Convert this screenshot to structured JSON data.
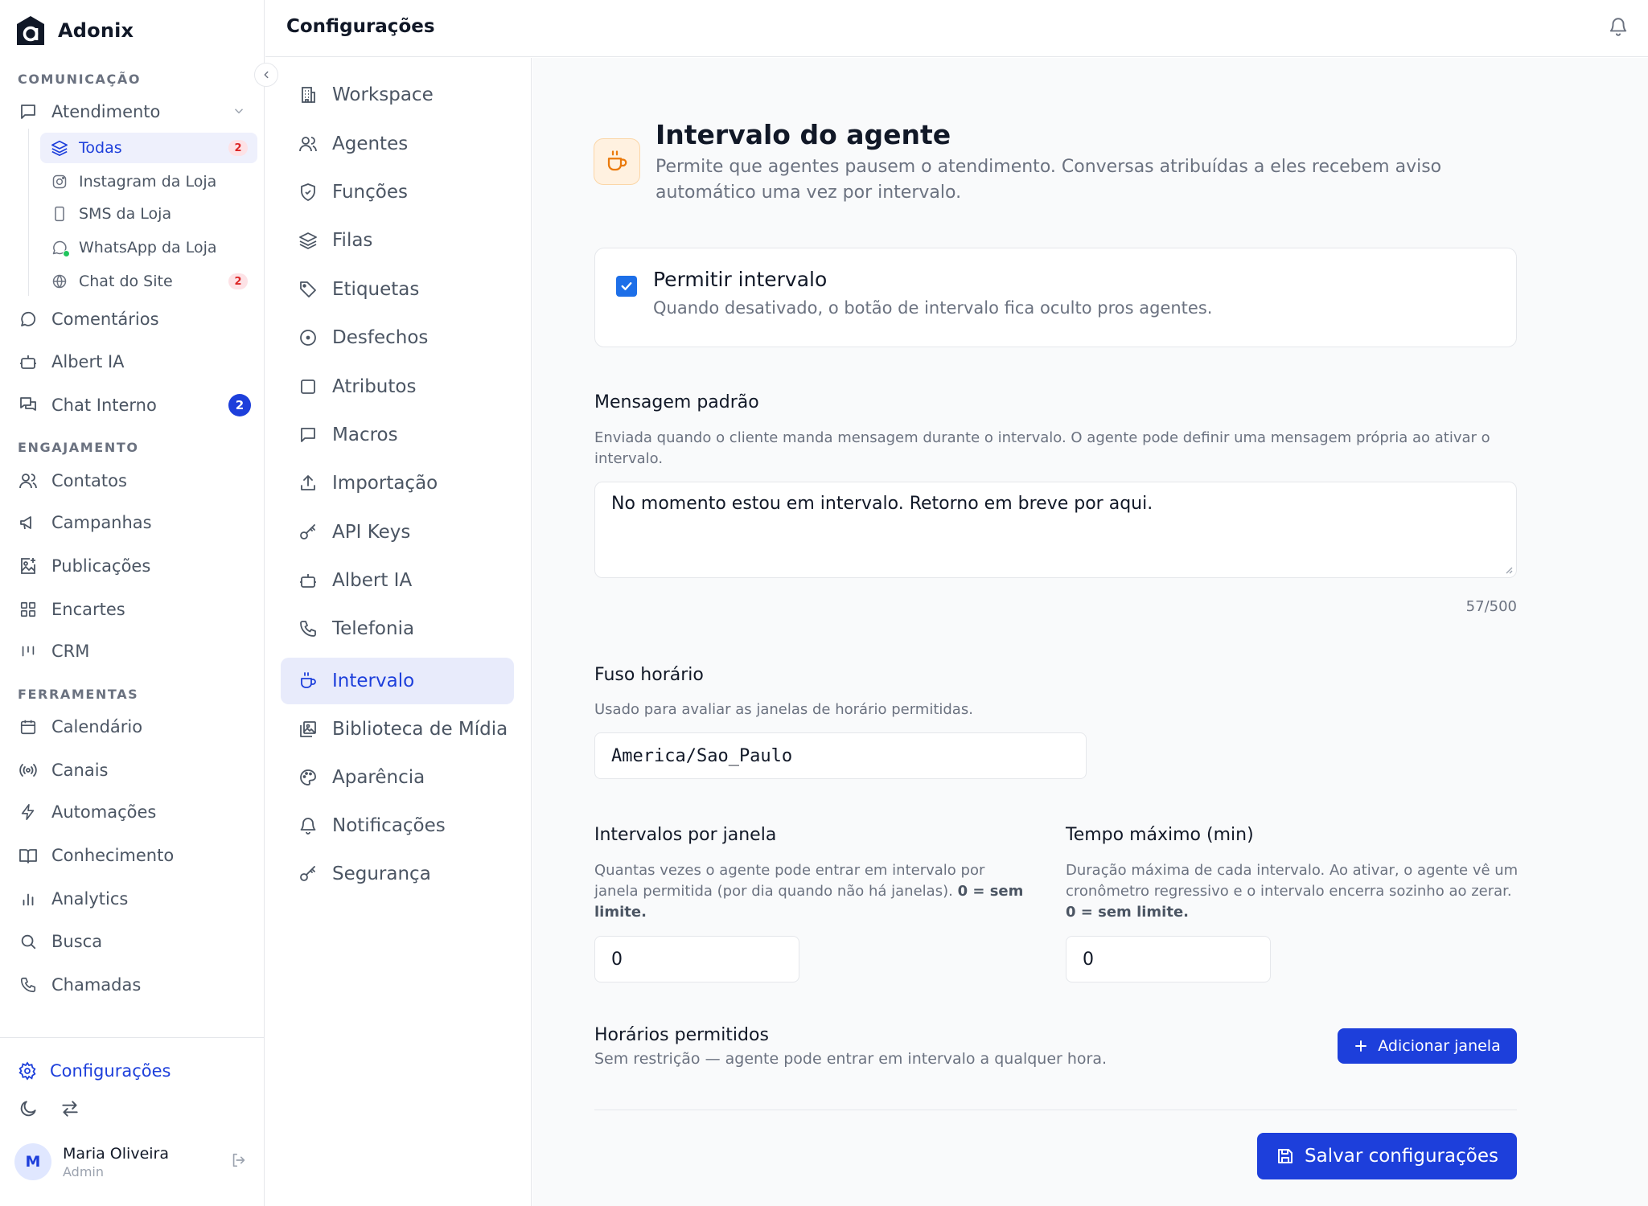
{
  "brand": {
    "name": "Adonix"
  },
  "sidebar": {
    "sections": {
      "comunicacao": "COMUNICAÇÃO",
      "engajamento": "ENGAJAMENTO",
      "ferramentas": "FERRAMENTAS"
    },
    "atendimento": {
      "label": "Atendimento",
      "icon": "message-square-icon"
    },
    "sub_items": [
      {
        "label": "Todas",
        "icon": "layers-icon",
        "badge": "2"
      },
      {
        "label": "Instagram da Loja",
        "icon": "instagram-icon"
      },
      {
        "label": "SMS da Loja",
        "icon": "phone-device-icon"
      },
      {
        "label": "WhatsApp da Loja",
        "icon": "whatsapp-icon"
      },
      {
        "label": "Chat do Site",
        "icon": "globe-icon",
        "badge": "2"
      }
    ],
    "comunicacao_items": [
      {
        "label": "Comentários",
        "icon": "comment-icon"
      },
      {
        "label": "Albert IA",
        "icon": "bot-icon"
      },
      {
        "label": "Chat Interno",
        "icon": "messages-icon",
        "badge": "2"
      }
    ],
    "engajamento_items": [
      {
        "label": "Contatos",
        "icon": "users-icon"
      },
      {
        "label": "Campanhas",
        "icon": "megaphone-icon"
      },
      {
        "label": "Publicações",
        "icon": "image-plus-icon"
      },
      {
        "label": "Encartes",
        "icon": "grid-icon"
      },
      {
        "label": "CRM",
        "icon": "kanban-icon"
      }
    ],
    "ferramentas_items": [
      {
        "label": "Calendário",
        "icon": "calendar-icon"
      },
      {
        "label": "Canais",
        "icon": "radio-icon"
      },
      {
        "label": "Automações",
        "icon": "zap-icon"
      },
      {
        "label": "Conhecimento",
        "icon": "book-icon"
      },
      {
        "label": "Analytics",
        "icon": "bar-chart-icon"
      },
      {
        "label": "Busca",
        "icon": "search-icon"
      },
      {
        "label": "Chamadas",
        "icon": "phone-icon"
      }
    ],
    "settings_label": "Configurações",
    "user": {
      "initial": "M",
      "name": "Maria Oliveira",
      "role": "Admin"
    }
  },
  "header": {
    "title": "Configurações"
  },
  "settings_nav": [
    {
      "label": "Workspace",
      "icon": "building-icon"
    },
    {
      "label": "Agentes",
      "icon": "users-icon"
    },
    {
      "label": "Funções",
      "icon": "shield-icon"
    },
    {
      "label": "Filas",
      "icon": "layers-icon"
    },
    {
      "label": "Etiquetas",
      "icon": "tag-icon"
    },
    {
      "label": "Desfechos",
      "icon": "target-icon"
    },
    {
      "label": "Atributos",
      "icon": "square-icon"
    },
    {
      "label": "Macros",
      "icon": "message-square-icon"
    },
    {
      "label": "Importação",
      "icon": "upload-icon"
    },
    {
      "label": "API Keys",
      "icon": "key-icon"
    },
    {
      "label": "Albert IA",
      "icon": "bot-icon"
    },
    {
      "label": "Telefonia",
      "icon": "phone-icon"
    },
    {
      "label": "Intervalo",
      "icon": "coffee-icon",
      "active": true
    },
    {
      "label": "Biblioteca de Mídia",
      "icon": "images-icon"
    },
    {
      "label": "Aparência",
      "icon": "palette-icon"
    },
    {
      "label": "Notificações",
      "icon": "bell-icon"
    },
    {
      "label": "Segurança",
      "icon": "key-icon"
    }
  ],
  "page": {
    "icon": "coffee-icon",
    "title": "Intervalo do agente",
    "description": "Permite que agentes pausem o atendimento. Conversas atribuídas a eles recebem aviso automático uma vez por intervalo.",
    "allow": {
      "checked": true,
      "label": "Permitir intervalo",
      "help": "Quando desativado, o botão de intervalo fica oculto pros agentes."
    },
    "default_message": {
      "label": "Mensagem padrão",
      "help": "Enviada quando o cliente manda mensagem durante o intervalo. O agente pode definir uma mensagem própria ao ativar o intervalo.",
      "value": "No momento estou em intervalo. Retorno em breve por aqui.",
      "counter": "57/500"
    },
    "timezone": {
      "label": "Fuso horário",
      "help": "Usado para avaliar as janelas de horário permitidas.",
      "value": "America/Sao_Paulo"
    },
    "per_window": {
      "label": "Intervalos por janela",
      "help": "Quantas vezes o agente pode entrar em intervalo por janela permitida (por dia quando não há janelas).",
      "help_bold": "0 = sem limite.",
      "value": "0"
    },
    "max_time": {
      "label": "Tempo máximo (min)",
      "help": "Duração máxima de cada intervalo. Ao ativar, o agente vê um cronômetro regressivo e o intervalo encerra sozinho ao zerar.",
      "help_bold": "0 = sem limite.",
      "value": "0"
    },
    "allowed_hours": {
      "label": "Horários permitidos",
      "help": "Sem restrição — agente pode entrar em intervalo a qualquer hora.",
      "add_button": "Adicionar janela"
    },
    "save_button": "Salvar configurações"
  },
  "colors": {
    "accent": "#1d3fdb",
    "warning_icon": "#ea7a0c",
    "badge_red": "#dc2626"
  }
}
